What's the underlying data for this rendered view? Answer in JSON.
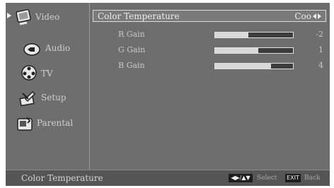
{
  "sidebar": {
    "items": [
      {
        "label": "Video",
        "icon": "monitor-icon",
        "selected": true
      },
      {
        "label": "Audio",
        "icon": "speaker-icon",
        "selected": false
      },
      {
        "label": "TV",
        "icon": "tv-reel-icon",
        "selected": false
      },
      {
        "label": "Setup",
        "icon": "setup-tools-icon",
        "selected": false
      },
      {
        "label": "Parental",
        "icon": "parental-lock-icon",
        "selected": false
      }
    ]
  },
  "main": {
    "color_temperature": {
      "label": "Color Temperature",
      "value": "Coo"
    },
    "gains": [
      {
        "label": "R Gain",
        "value": "-2",
        "level": 0.43
      },
      {
        "label": "G Gain",
        "value": "1",
        "level": 0.55
      },
      {
        "label": "B Gain",
        "value": "4",
        "level": 0.72
      }
    ]
  },
  "footer": {
    "title": "Color Temperature",
    "nav_key": "◀▶/▲▼",
    "select_label": "Select",
    "exit_key": "EXIT",
    "back_label": "Back"
  },
  "colors": {
    "background": "#6e6e6e",
    "highlight_border": "#dddddd",
    "bar_fill": "#d9d9d9",
    "bar_track": "#3c3c3c"
  }
}
